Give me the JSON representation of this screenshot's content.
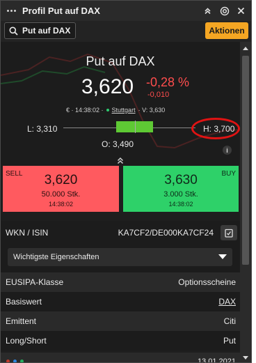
{
  "window": {
    "title": "Profil Put auf DAX"
  },
  "colors": {
    "accent": "#f5a623",
    "sell": "#ff5a5f",
    "buy": "#2ed169",
    "negative": "#ff4d4d",
    "range_box": "#5ec934",
    "highlight_circle": "#e01313"
  },
  "search": {
    "text": "Put auf DAX"
  },
  "header": {
    "actions_label": "Aktionen"
  },
  "quote": {
    "name": "Put auf DAX",
    "price": "3,620",
    "change_pct": "-0,28 %",
    "change_abs": "-0,010",
    "meta_prefix": "€ · 14:38:02 ·",
    "exchange": "Stuttgart",
    "volume": "· V: 3,630",
    "low": "L: 3,310",
    "high": "H: 3,700",
    "open": "O: 3,490",
    "info_label": "i"
  },
  "sell": {
    "tag": "SELL",
    "price": "3,620",
    "qty": "50.000 Stk.",
    "time": "14:38:02"
  },
  "buy": {
    "tag": "BUY",
    "price": "3,630",
    "qty": "3.000 Stk.",
    "time": "14:38:02"
  },
  "wkn": {
    "label": "WKN / ISIN",
    "value": "KA7CF2/DE000KA7CF24"
  },
  "dropdown": {
    "selected": "Wichtigste Eigenschaften"
  },
  "properties": [
    {
      "label": "EUSIPA-Klasse",
      "value": "Optionsscheine"
    },
    {
      "label": "Basiswert",
      "value": "DAX"
    },
    {
      "label": "Emittent",
      "value": "Citi"
    },
    {
      "label": "Long/Short",
      "value": "Put"
    }
  ],
  "partial_row": {
    "value": "13.01.2021"
  },
  "icons": [
    "more-dots-icon",
    "double-chevron-up-icon",
    "target-icon",
    "close-icon",
    "search-icon",
    "copy-icon",
    "chevron-down-icon",
    "info-icon",
    "loading-dots-icon"
  ]
}
